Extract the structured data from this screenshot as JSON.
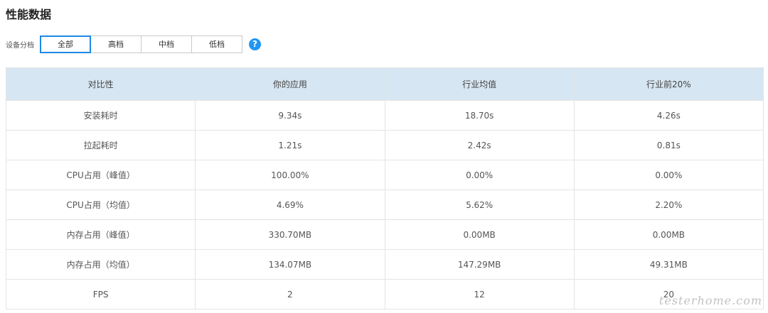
{
  "page": {
    "title": "性能数据"
  },
  "filter": {
    "label": "设备分档",
    "options": [
      "全部",
      "高档",
      "中档",
      "低档"
    ],
    "selected": "全部",
    "help_glyph": "?"
  },
  "table": {
    "headers": [
      "对比性",
      "你的应用",
      "行业均值",
      "行业前20%"
    ],
    "rows": [
      {
        "metric": "安装耗时",
        "app": "9.34s",
        "avg": "18.70s",
        "top": "4.26s",
        "app_status": "good"
      },
      {
        "metric": "拉起耗时",
        "app": "1.21s",
        "avg": "2.42s",
        "top": "0.81s",
        "app_status": "good"
      },
      {
        "metric": "CPU占用（峰值）",
        "app": "100.00%",
        "avg": "0.00%",
        "top": "0.00%",
        "app_status": "bad"
      },
      {
        "metric": "CPU占用（均值）",
        "app": "4.69%",
        "avg": "5.62%",
        "top": "2.20%",
        "app_status": "good"
      },
      {
        "metric": "内存占用（峰值）",
        "app": "330.70MB",
        "avg": "0.00MB",
        "top": "0.00MB",
        "app_status": "bad"
      },
      {
        "metric": "内存占用（均值）",
        "app": "134.07MB",
        "avg": "147.29MB",
        "top": "49.31MB",
        "app_status": "good"
      },
      {
        "metric": "FPS",
        "app": "2",
        "avg": "12",
        "top": "20",
        "app_status": "bad"
      }
    ]
  },
  "colors": {
    "good": "#2e8b2e",
    "bad": "#e53935",
    "header_bg": "#d6e6f2",
    "accent": "#1e88e5"
  },
  "watermark": "testerhome.com"
}
